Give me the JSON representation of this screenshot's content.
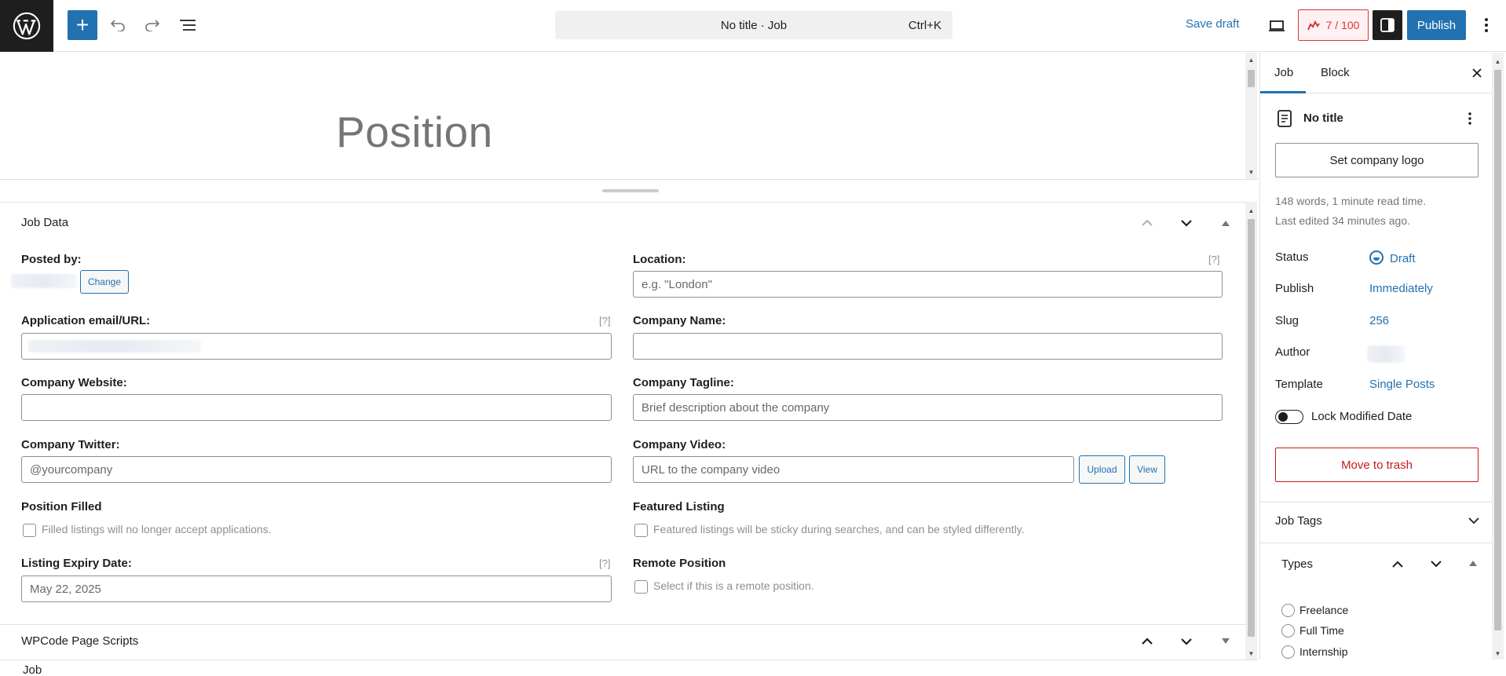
{
  "topbar": {
    "command_title": "No title · Job",
    "command_shortcut": "Ctrl+K",
    "save_draft": "Save draft",
    "score": "7 / 100",
    "publish": "Publish"
  },
  "editor": {
    "title_placeholder": "Position"
  },
  "job_data": {
    "title": "Job Data",
    "posted_by_label": "Posted by:",
    "change_button": "Change",
    "location_label": "Location:",
    "location_placeholder": "e.g. \"London\"",
    "application_label": "Application email/URL:",
    "company_name_label": "Company Name:",
    "company_website_label": "Company Website:",
    "company_tagline_label": "Company Tagline:",
    "company_tagline_placeholder": "Brief description about the company",
    "company_twitter_label": "Company Twitter:",
    "company_twitter_placeholder": "@yourcompany",
    "company_video_label": "Company Video:",
    "company_video_placeholder": "URL to the company video",
    "upload_button": "Upload",
    "view_button": "View",
    "position_filled_label": "Position Filled",
    "position_filled_desc": "Filled listings will no longer accept applications.",
    "featured_label": "Featured Listing",
    "featured_desc": "Featured listings will be sticky during searches, and can be styled differently.",
    "expiry_label": "Listing Expiry Date:",
    "expiry_value": "May 22, 2025",
    "remote_label": "Remote Position",
    "remote_desc": "Select if this is a remote position.",
    "help_marker": "[?]"
  },
  "wpcode": {
    "title": "WPCode Page Scripts"
  },
  "footer": {
    "breadcrumb": "Job"
  },
  "sidebar": {
    "tabs": [
      "Job",
      "Block"
    ],
    "doc_title": "No title",
    "logo_button": "Set company logo",
    "read_time": "148 words, 1 minute read time.",
    "last_edited": "Last edited 34 minutes ago.",
    "rows": [
      {
        "label": "Status",
        "value": "Draft"
      },
      {
        "label": "Publish",
        "value": "Immediately"
      },
      {
        "label": "Slug",
        "value": "256"
      },
      {
        "label": "Author",
        "value": ""
      },
      {
        "label": "Template",
        "value": "Single Posts"
      }
    ],
    "lock_modified": "Lock Modified Date",
    "trash": "Move to trash",
    "job_tags": "Job Tags",
    "types_title": "Types",
    "types": [
      "Freelance",
      "Full Time",
      "Internship"
    ]
  },
  "colors": {
    "accent": "#2271b1",
    "danger": "#cc1818",
    "score": "#d63638"
  }
}
